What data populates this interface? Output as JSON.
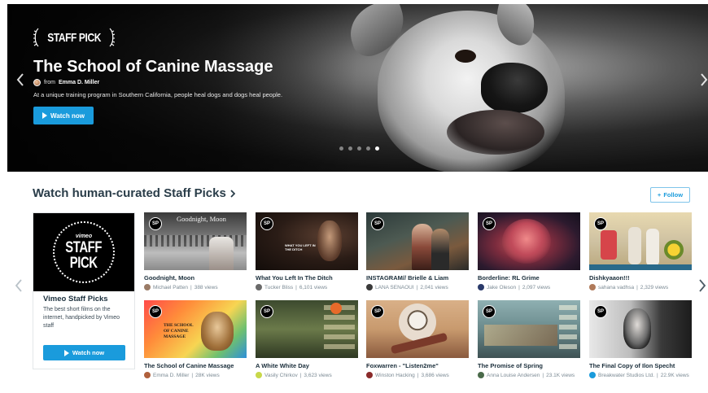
{
  "hero": {
    "badge": "STAFF PICK",
    "title": "The School of Canine Massage",
    "from_label": "from",
    "author": "Emma D. Miller",
    "description": "At a unique training program in Southern California, people heal dogs and dogs heal people.",
    "watch_label": "Watch now",
    "dots_total": 5,
    "dots_active_index": 4
  },
  "section": {
    "title": "Watch human-curated Staff Picks",
    "follow_label": "Follow"
  },
  "staff_picks_card": {
    "logo_small": "vimeo",
    "logo_line1": "STAFF",
    "logo_line2": "PICK",
    "title": "Vimeo Staff Picks",
    "description": "The best short films on the internet, handpicked by Vimeo staff",
    "watch_label": "Watch now"
  },
  "sp_mini_label": "SP",
  "videos": [
    {
      "title": "Goodnight, Moon",
      "author": "Michael Patten",
      "views": "388 views",
      "avatar_color": "#9a7b66",
      "thumb_caption": "Goodnight, Moon"
    },
    {
      "title": "What You Left In The Ditch",
      "author": "Tucker Bliss",
      "views": "6,101 views",
      "avatar_color": "#6a6a6a",
      "thumb_caption": "WHAT YOU LEFT IN THE DITCH"
    },
    {
      "title": "INSTAGRAM// Brielle & Liam",
      "author": "LANA SENAOUI",
      "views": "2,041 views",
      "avatar_color": "#3a3a3a",
      "thumb_caption": ""
    },
    {
      "title": "Borderline: RL Grime",
      "author": "Jake Oleson",
      "views": "2,097 views",
      "avatar_color": "#2a3a6a",
      "thumb_caption": ""
    },
    {
      "title": "Dishkyaaon!!!",
      "author": "sahana vadhsa",
      "views": "2,329 views",
      "avatar_color": "#b07a5a",
      "thumb_caption": ""
    },
    {
      "title": "The School of Canine Massage",
      "author": "Emma D. Miller",
      "views": "28K views",
      "avatar_color": "#b0603c",
      "thumb_caption": "THE SCHOOL OF CANINE MASSAGE"
    },
    {
      "title": "A White White Day",
      "author": "Vasily Chirkov",
      "views": "3,623 views",
      "avatar_color": "#c8d84a",
      "thumb_caption": ""
    },
    {
      "title": "Foxwarren - \"Listen2me\"",
      "author": "Winston Hacking",
      "views": "3,686 views",
      "avatar_color": "#8a2a2a",
      "thumb_caption": ""
    },
    {
      "title": "The Promise of Spring",
      "author": "Anna Louise Andersen",
      "views": "23.1K views",
      "avatar_color": "#4a6a4a",
      "thumb_caption": ""
    },
    {
      "title": "The Final Copy of Ilon Specht",
      "author": "Breakwater Studios Ltd.",
      "views": "22.9K views",
      "avatar_color": "#1a9bdc",
      "thumb_caption": ""
    }
  ],
  "colors": {
    "accent": "#1a9bdc",
    "text_dark": "#1a2e3b",
    "meta_gray": "#7b8a94"
  },
  "icons": {
    "hero_prev": "chevron-left-icon",
    "hero_next": "chevron-right-icon",
    "carousel_prev": "chevron-left-icon",
    "carousel_next": "chevron-right-icon",
    "play": "play-icon",
    "follow_plus": "plus-icon"
  }
}
